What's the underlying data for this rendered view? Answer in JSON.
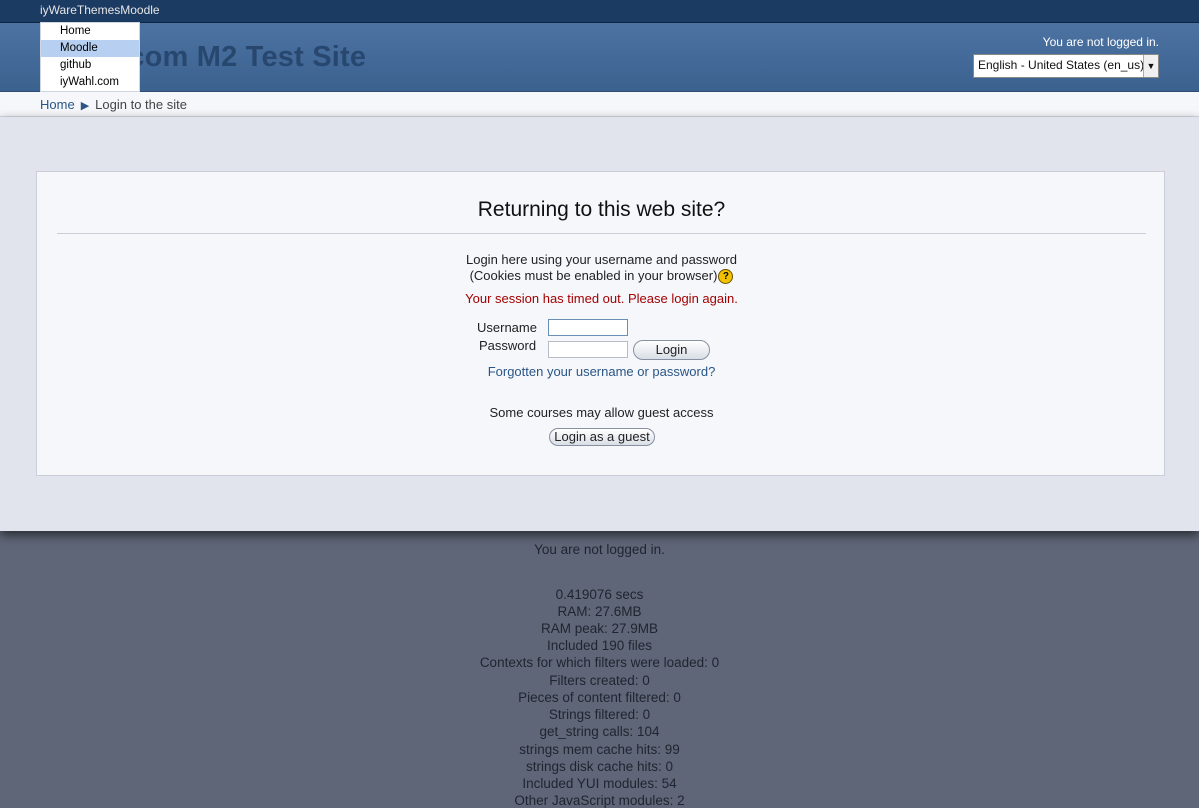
{
  "topbar": {
    "brand": "iyWareThemesMoodle"
  },
  "custom_menu": {
    "items": [
      "Home",
      "Moodle",
      "github",
      "iyWahl.com"
    ],
    "active_item": "Moodle"
  },
  "header": {
    "site_name": ".com M2 Test Site",
    "login_status": "You are not logged in.",
    "language": "English - United States (en_us)"
  },
  "breadcrumb": {
    "home": "Home",
    "separator": "▶",
    "current": "Login to the site"
  },
  "login": {
    "heading": "Returning to this web site?",
    "instructions_line1": "Login here using your username and password",
    "instructions_line2": "(Cookies must be enabled in your browser)",
    "help_glyph": "?",
    "error": "Your session has timed out. Please login again.",
    "username_label": "Username",
    "password_label": "Password",
    "login_button": "Login",
    "forgot_link": "Forgotten your username or password?",
    "guest_note": "Some courses may allow guest access",
    "guest_button": "Login as a guest"
  },
  "footer": {
    "lines": [
      "You are not logged in.",
      "",
      "0.419076 secs",
      "RAM: 27.6MB",
      "RAM peak: 27.9MB",
      "Included 190 files",
      "Contexts for which filters were loaded: 0",
      "Filters created: 0",
      "Pieces of content filtered: 0",
      "Strings filtered: 0",
      "get_string calls: 104",
      "strings mem cache hits: 99",
      "strings disk cache hits: 0",
      "Included YUI modules: 54",
      "Other JavaScript modules: 2"
    ]
  },
  "colors": {
    "topbar": "#1c3b62",
    "header": "#4368a0",
    "link": "#2a5586",
    "error": "#a40000",
    "footer_bg": "#5f6677"
  }
}
